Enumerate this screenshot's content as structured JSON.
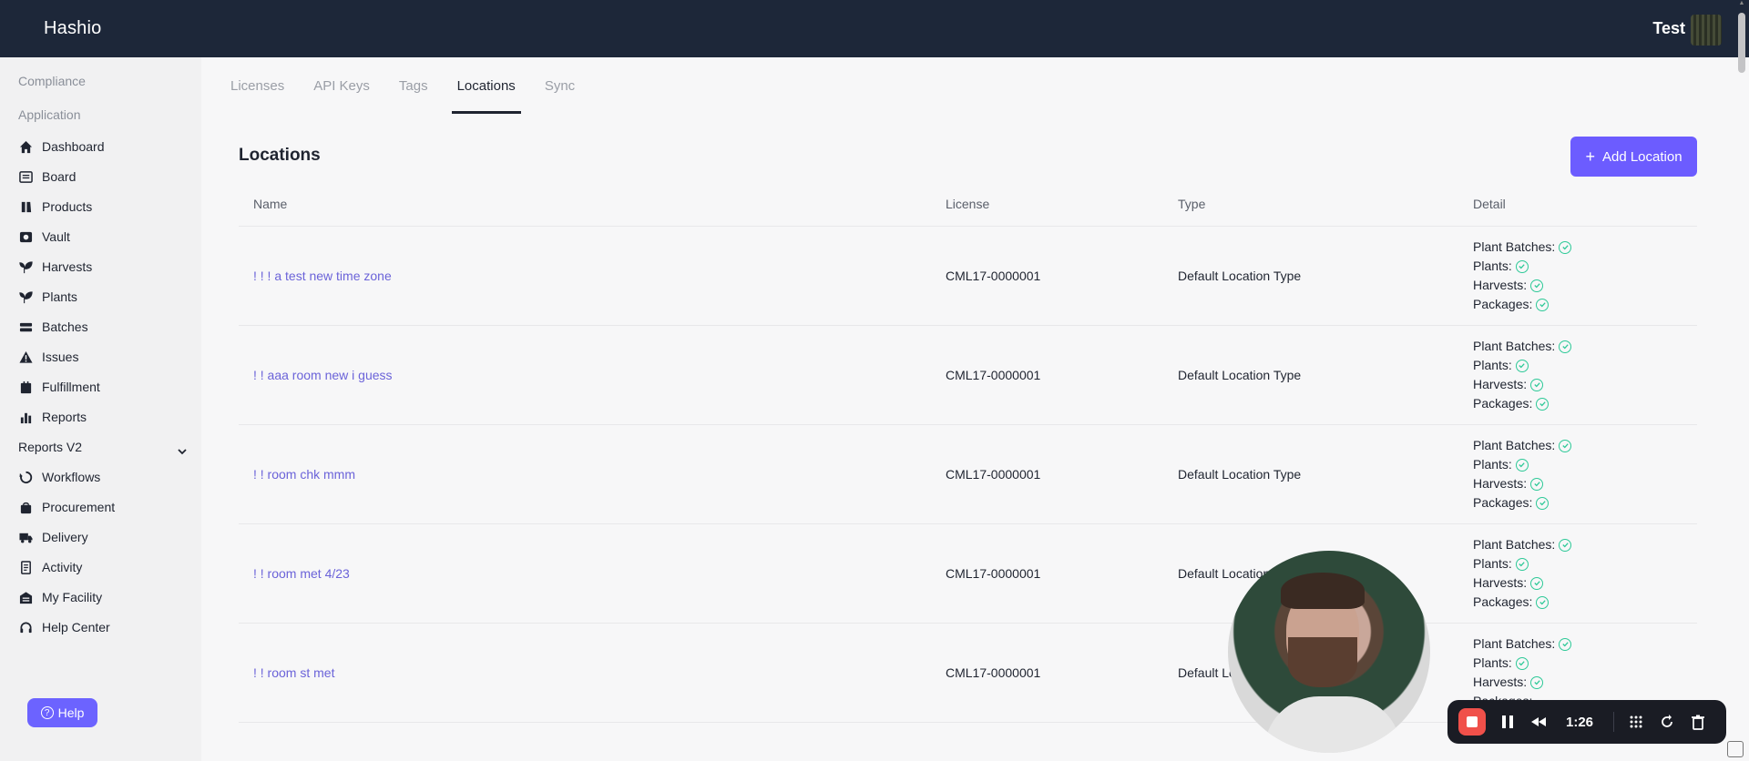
{
  "app": {
    "brand": "Hashio",
    "user": "Test"
  },
  "sidebar": {
    "sections": [
      "Compliance",
      "Application"
    ],
    "items": [
      {
        "label": "Dashboard",
        "icon": "home-icon"
      },
      {
        "label": "Board",
        "icon": "board-icon"
      },
      {
        "label": "Products",
        "icon": "products-icon"
      },
      {
        "label": "Vault",
        "icon": "vault-icon"
      },
      {
        "label": "Harvests",
        "icon": "harvests-icon"
      },
      {
        "label": "Plants",
        "icon": "plants-icon"
      },
      {
        "label": "Batches",
        "icon": "batches-icon"
      },
      {
        "label": "Issues",
        "icon": "warning-icon"
      },
      {
        "label": "Fulfillment",
        "icon": "fulfillment-icon"
      },
      {
        "label": "Reports",
        "icon": "reports-icon"
      },
      {
        "label": "Reports V2",
        "icon": ""
      },
      {
        "label": "Workflows",
        "icon": "workflows-icon"
      },
      {
        "label": "Procurement",
        "icon": "procurement-icon"
      },
      {
        "label": "Delivery",
        "icon": "delivery-icon"
      },
      {
        "label": "Activity",
        "icon": "activity-icon"
      },
      {
        "label": "My Facility",
        "icon": "facility-icon"
      },
      {
        "label": "Help Center",
        "icon": "headset-icon"
      }
    ],
    "help_label": "Help"
  },
  "tabs": [
    {
      "label": "Licenses",
      "active": false
    },
    {
      "label": "API Keys",
      "active": false
    },
    {
      "label": "Tags",
      "active": false
    },
    {
      "label": "Locations",
      "active": true
    },
    {
      "label": "Sync",
      "active": false
    }
  ],
  "page": {
    "title": "Locations",
    "add_button": "Add Location"
  },
  "table": {
    "headers": {
      "name": "Name",
      "license": "License",
      "type": "Type",
      "detail": "Detail"
    },
    "detail_labels": [
      "Plant Batches:",
      "Plants:",
      "Harvests:",
      "Packages:"
    ],
    "rows": [
      {
        "name": "! ! ! a test new time zone",
        "license": "CML17-0000001",
        "type": "Default Location Type"
      },
      {
        "name": "! ! aaa room new i guess",
        "license": "CML17-0000001",
        "type": "Default Location Type"
      },
      {
        "name": "! ! room chk mmm",
        "license": "CML17-0000001",
        "type": "Default Location Type"
      },
      {
        "name": "! ! room met 4/23",
        "license": "CML17-0000001",
        "type": "Default Location Type"
      },
      {
        "name": "! ! room st met",
        "license": "CML17-0000001",
        "type": "Default Location Type"
      }
    ]
  },
  "recorder": {
    "time": "1:26"
  },
  "colors": {
    "topbar": "#1d2739",
    "accent": "#6c5cff",
    "check": "#2dc997",
    "link": "#6b63d9"
  }
}
